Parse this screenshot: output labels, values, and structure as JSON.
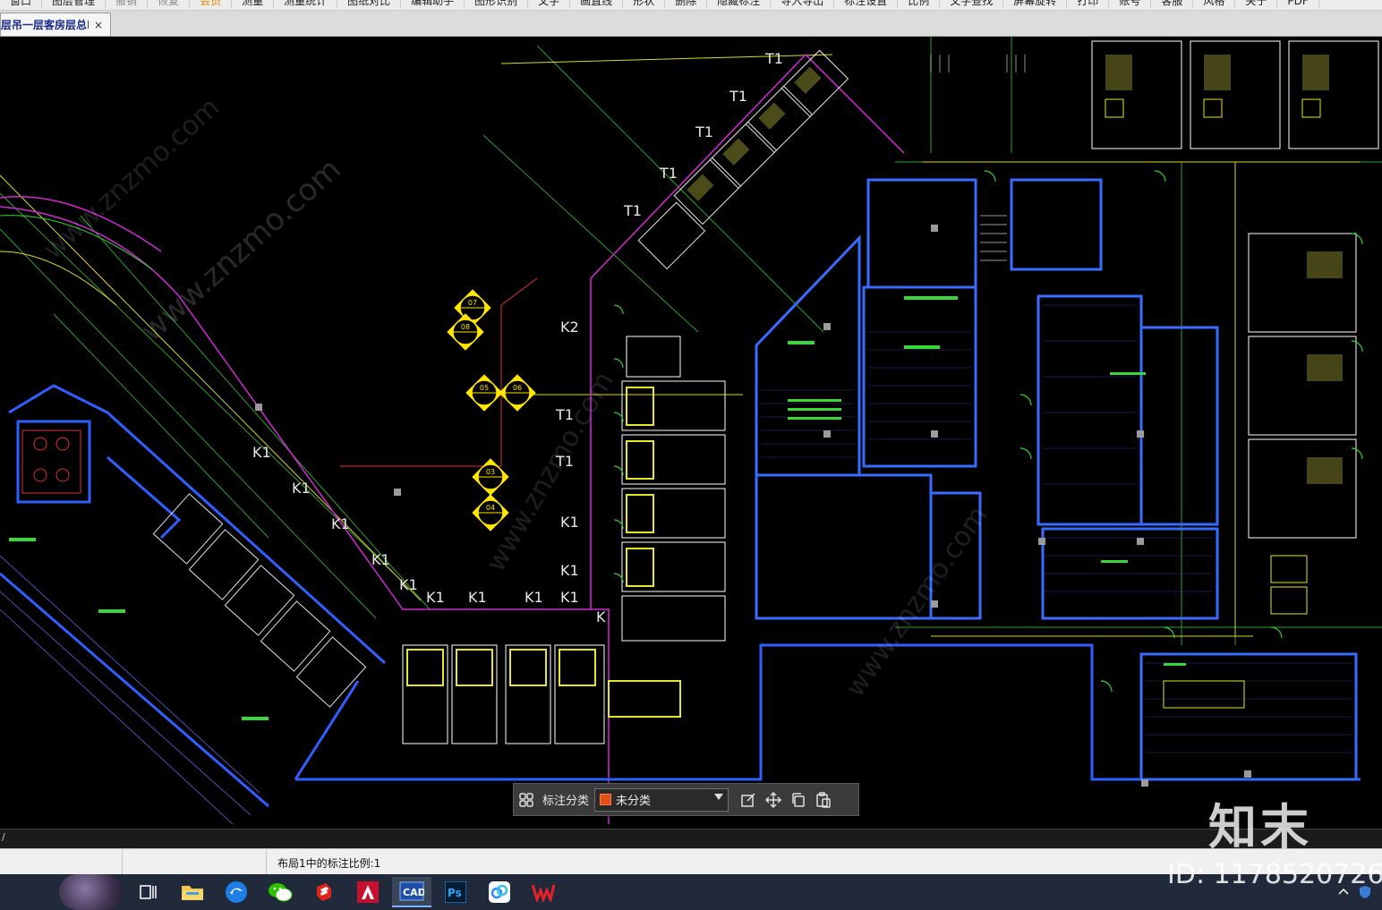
{
  "menu": {
    "items": [
      {
        "label": "窗口",
        "style": ""
      },
      {
        "label": "图层管理",
        "style": ""
      },
      {
        "label": "撤销",
        "style": "dim"
      },
      {
        "label": "恢复",
        "style": "dim"
      },
      {
        "label": "会员",
        "style": "vip"
      },
      {
        "label": "测量",
        "style": ""
      },
      {
        "label": "测量统计",
        "style": ""
      },
      {
        "label": "图纸对比",
        "style": ""
      },
      {
        "label": "编辑助手",
        "style": ""
      },
      {
        "label": "图形识别",
        "style": ""
      },
      {
        "label": "文字",
        "style": ""
      },
      {
        "label": "画直线",
        "style": ""
      },
      {
        "label": "形状",
        "style": ""
      },
      {
        "label": "删除",
        "style": ""
      },
      {
        "label": "隐藏标注",
        "style": ""
      },
      {
        "label": "导入导出",
        "style": ""
      },
      {
        "label": "标注设置",
        "style": ""
      },
      {
        "label": "比例",
        "style": ""
      },
      {
        "label": "文字查找",
        "style": ""
      },
      {
        "label": "屏幕旋转",
        "style": ""
      },
      {
        "label": "打印",
        "style": ""
      },
      {
        "label": "账号",
        "style": ""
      },
      {
        "label": "客服",
        "style": ""
      },
      {
        "label": "风格",
        "style": ""
      },
      {
        "label": "关于",
        "style": ""
      },
      {
        "label": "PDF",
        "style": ""
      }
    ]
  },
  "document_tab": {
    "title": "层吊一层客房层总I",
    "close": "×"
  },
  "drawing": {
    "labels": [
      "T1",
      "T1",
      "T1",
      "T1",
      "T1",
      "T1",
      "T1",
      "K2",
      "K1",
      "K1",
      "K1",
      "K1",
      "K1",
      "K1",
      "K1",
      "K1",
      "K1",
      "K1",
      "K1",
      "K"
    ],
    "callouts": [
      "07",
      "08",
      "05",
      "06",
      "03",
      "04"
    ]
  },
  "annotation_toolbar": {
    "category_label": "标注分类",
    "selected_category": "未分类",
    "category_color": "#e0501a",
    "icons": [
      "grid-icon",
      "edit-icon",
      "move-icon",
      "copy-icon",
      "paste-icon"
    ]
  },
  "command_line": {
    "text": "/"
  },
  "status_bar": {
    "text": "布局1中的标注比例:1"
  },
  "taskbar": {
    "apps": [
      "task-view",
      "file-explorer",
      "browser",
      "wechat",
      "sketchup",
      "autocad",
      "cad-viewer",
      "photoshop",
      "baidu-netdisk",
      "wps"
    ],
    "active": "cad-viewer"
  },
  "watermark": {
    "logo": "知末",
    "id": "ID: 1178520726",
    "diagonal": "www.znzmo.com"
  }
}
